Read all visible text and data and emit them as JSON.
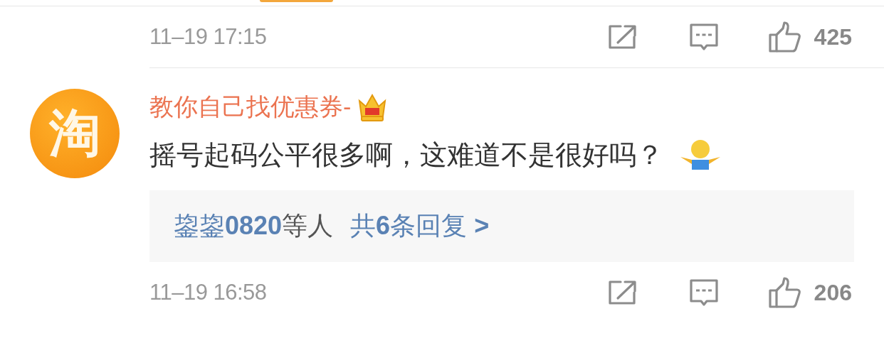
{
  "top_row": {
    "time": "11–19 17:15",
    "likes": "425"
  },
  "comment": {
    "avatar_text": "淘",
    "username": "教你自己找优惠券-",
    "text": "摇号起码公平很多啊，这难道不是很好吗？",
    "replies": {
      "names": "鋆鋆**0820**",
      "suffix": "等人",
      "link": "共**6**条回复 **>**"
    },
    "footer": {
      "time": "11–19 16:58",
      "likes": "206"
    }
  }
}
